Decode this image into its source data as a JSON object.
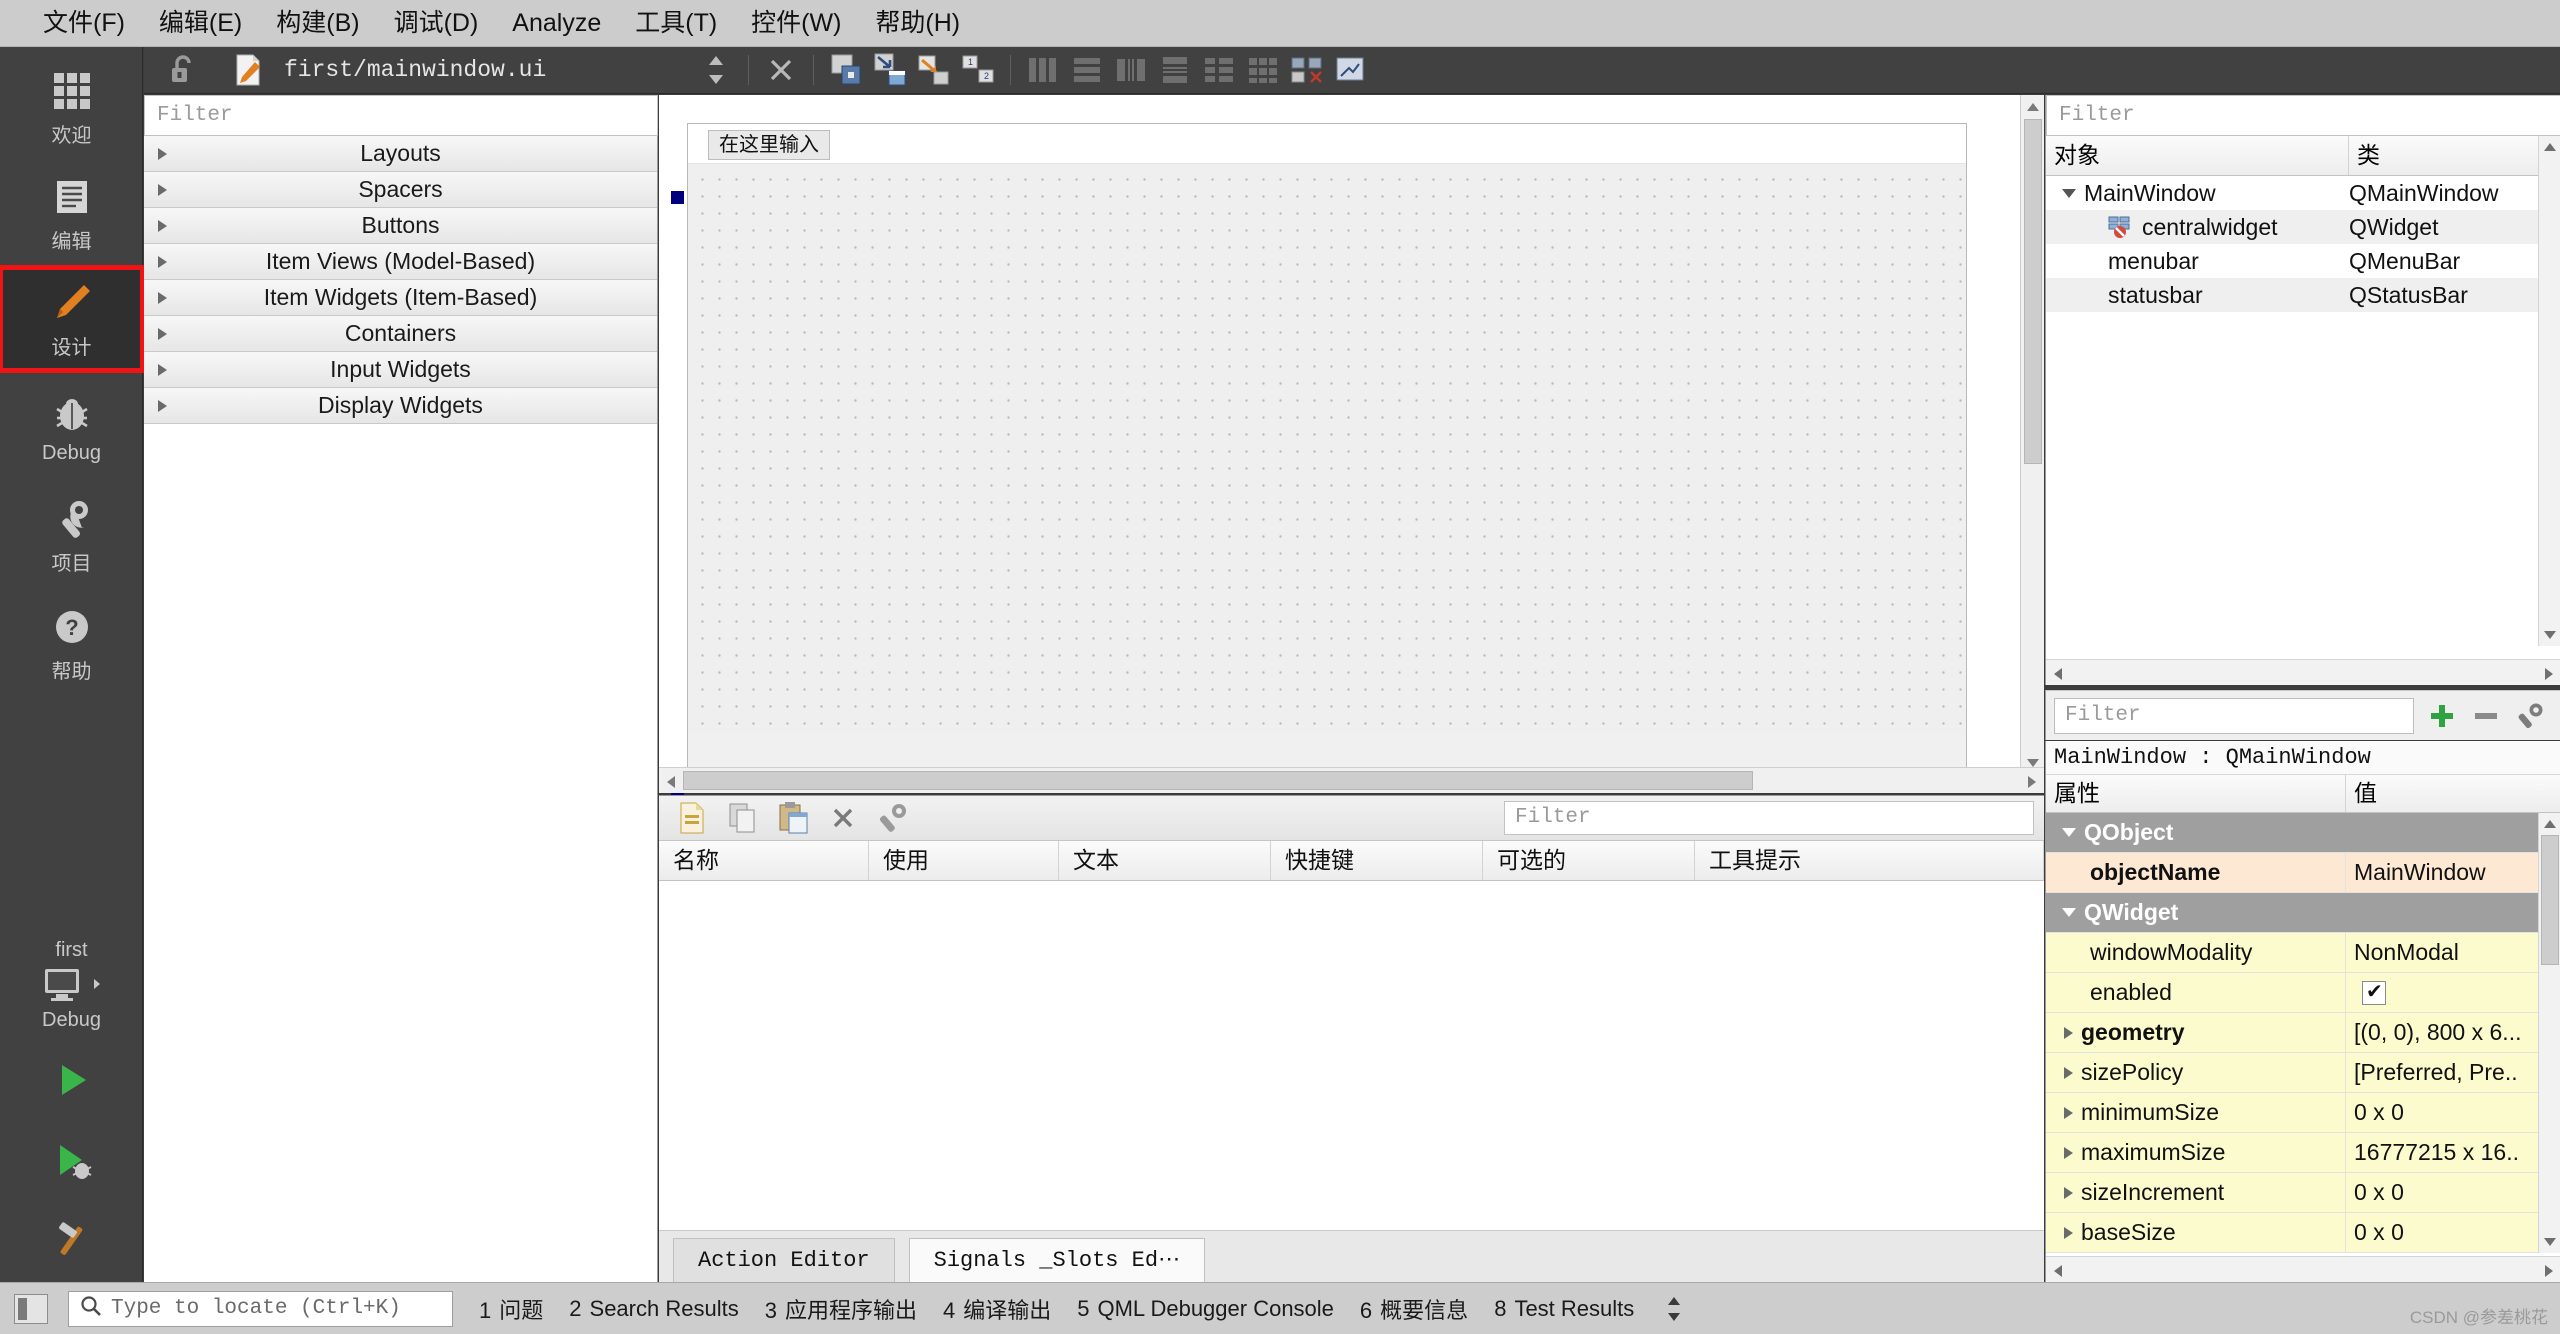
{
  "menubar": {
    "items": [
      {
        "label": "文件(F)",
        "name": "menu-file"
      },
      {
        "label": "编辑(E)",
        "name": "menu-edit"
      },
      {
        "label": "构建(B)",
        "name": "menu-build"
      },
      {
        "label": "调试(D)",
        "name": "menu-debug"
      },
      {
        "label": "Analyze",
        "name": "menu-analyze"
      },
      {
        "label": "工具(T)",
        "name": "menu-tools"
      },
      {
        "label": "控件(W)",
        "name": "menu-window"
      },
      {
        "label": "帮助(H)",
        "name": "menu-help"
      }
    ]
  },
  "modebar": {
    "items": [
      {
        "label": "欢迎",
        "icon": "grid-icon",
        "selected": false
      },
      {
        "label": "编辑",
        "icon": "document-lines-icon",
        "selected": false
      },
      {
        "label": "设计",
        "icon": "pencil-icon",
        "selected": true
      },
      {
        "label": "Debug",
        "icon": "bug-icon",
        "selected": false
      },
      {
        "label": "项目",
        "icon": "wrench-icon",
        "selected": false
      },
      {
        "label": "帮助",
        "icon": "question-circle-icon",
        "selected": false
      }
    ],
    "kit": {
      "project": "first",
      "build_config": "Debug",
      "computer_icon": "monitor-icon",
      "chevron": "chevron-right-icon"
    },
    "run_buttons": [
      {
        "name": "run-button",
        "icon": "play-triangle-icon"
      },
      {
        "name": "debug-button",
        "icon": "play-bug-icon"
      },
      {
        "name": "build-button",
        "icon": "hammer-icon"
      }
    ]
  },
  "editor_toolbar": {
    "lock_icon": "unlocked-padlock-icon",
    "file_icon": "file-pencil-icon",
    "file_path": "first/mainwindow.ui",
    "split_icon": "updown-arrows-icon",
    "close_icon": "close-x-icon",
    "design_tools": [
      {
        "name": "edit-widgets-tool",
        "icon": "edit-widgets-icon"
      },
      {
        "name": "edit-signals-slots-tool",
        "icon": "signals-slots-icon"
      },
      {
        "name": "edit-buddies-tool",
        "icon": "buddies-icon"
      },
      {
        "name": "edit-tab-order-tool",
        "icon": "tab-order-icon"
      },
      {
        "name": "layout-horizontally-tool",
        "icon": "layout-horizontal-icon"
      },
      {
        "name": "layout-vertically-tool",
        "icon": "layout-vertical-icon"
      },
      {
        "name": "layout-splitter-horizontal-tool",
        "icon": "split-horizontal-icon"
      },
      {
        "name": "layout-splitter-vertical-tool",
        "icon": "split-vertical-icon"
      },
      {
        "name": "layout-form-tool",
        "icon": "layout-form-icon"
      },
      {
        "name": "layout-grid-tool",
        "icon": "layout-grid-icon"
      },
      {
        "name": "break-layout-tool",
        "icon": "break-layout-icon"
      },
      {
        "name": "adjust-size-tool",
        "icon": "adjust-size-icon"
      }
    ]
  },
  "widget_box": {
    "filter_placeholder": "Filter",
    "filter_value": "",
    "categories": [
      {
        "label": "Layouts"
      },
      {
        "label": "Spacers"
      },
      {
        "label": "Buttons"
      },
      {
        "label": "Item Views (Model-Based)"
      },
      {
        "label": "Item Widgets (Item-Based)"
      },
      {
        "label": "Containers"
      },
      {
        "label": "Input Widgets"
      },
      {
        "label": "Display Widgets"
      }
    ]
  },
  "form_canvas": {
    "menu_placeholder": "在这里输入",
    "selection_handles": 3
  },
  "action_editor": {
    "filter_placeholder": "Filter",
    "filter_value": "",
    "toolbar_icons": [
      {
        "name": "new-action-button",
        "icon": "new-action-icon"
      },
      {
        "name": "copy-action-button",
        "icon": "copy-icon"
      },
      {
        "name": "paste-action-button",
        "icon": "paste-icon"
      },
      {
        "name": "delete-action-button",
        "icon": "delete-x-icon"
      },
      {
        "name": "edit-action-button",
        "icon": "wrench-small-icon"
      }
    ],
    "columns": [
      "名称",
      "使用",
      "文本",
      "快捷键",
      "可选的",
      "工具提示"
    ],
    "rows": [],
    "tabs": [
      {
        "label": "Action Editor",
        "active": false
      },
      {
        "label": "Signals _Slots Ed⋯",
        "active": true
      }
    ]
  },
  "object_inspector": {
    "filter_placeholder": "Filter",
    "filter_value": "",
    "columns": [
      "对象",
      "类"
    ],
    "rows": [
      {
        "name": "MainWindow",
        "class": "QMainWindow",
        "depth": 0,
        "expander": "caret-down-icon",
        "icon": ""
      },
      {
        "name": "centralwidget",
        "class": "QWidget",
        "depth": 1,
        "expander": "",
        "icon": "no-layout-icon"
      },
      {
        "name": "menubar",
        "class": "QMenuBar",
        "depth": 1,
        "expander": "",
        "icon": ""
      },
      {
        "name": "statusbar",
        "class": "QStatusBar",
        "depth": 1,
        "expander": "",
        "icon": ""
      }
    ]
  },
  "property_filter": {
    "placeholder": "Filter",
    "value": "",
    "buttons": [
      {
        "name": "add-property-button",
        "icon": "plus-green-icon"
      },
      {
        "name": "remove-property-button",
        "icon": "minus-gray-icon"
      },
      {
        "name": "configure-button",
        "icon": "wrench-icon"
      }
    ]
  },
  "property_editor": {
    "title": "MainWindow : QMainWindow",
    "columns": [
      "属性",
      "值"
    ],
    "rows": [
      {
        "prop": "QObject",
        "value": "",
        "kind": "group",
        "expander": "caret-down-icon"
      },
      {
        "prop": "objectName",
        "value": "MainWindow",
        "kind": "peach",
        "bold": true,
        "expander": ""
      },
      {
        "prop": "QWidget",
        "value": "",
        "kind": "group",
        "expander": "caret-down-icon"
      },
      {
        "prop": "windowModality",
        "value": "NonModal",
        "kind": "yellow",
        "expander": ""
      },
      {
        "prop": "enabled",
        "value": "",
        "kind": "yellow",
        "expander": "",
        "checkbox": true
      },
      {
        "prop": "geometry",
        "value": "[(0, 0), 800 x 6...",
        "kind": "yellow",
        "bold": true,
        "expander": "caret-right-icon"
      },
      {
        "prop": "sizePolicy",
        "value": "[Preferred, Pre..",
        "kind": "yellow",
        "expander": "caret-right-icon"
      },
      {
        "prop": "minimumSize",
        "value": "0 x 0",
        "kind": "yellow",
        "expander": "caret-right-icon"
      },
      {
        "prop": "maximumSize",
        "value": "16777215 x 16..",
        "kind": "yellow",
        "expander": "caret-right-icon"
      },
      {
        "prop": "sizeIncrement",
        "value": "0 x 0",
        "kind": "yellow",
        "expander": "caret-right-icon"
      },
      {
        "prop": "baseSize",
        "value": "0 x 0",
        "kind": "yellow",
        "expander": "caret-right-icon"
      }
    ]
  },
  "statusbar": {
    "sidebar_toggle": "sidebar-toggle-icon",
    "locator": {
      "icon": "search-icon",
      "placeholder": "Type to locate (Ctrl+K)",
      "value": ""
    },
    "outputs": [
      {
        "num": "1",
        "label": "问题"
      },
      {
        "num": "2",
        "label": "Search Results"
      },
      {
        "num": "3",
        "label": "应用程序输出"
      },
      {
        "num": "4",
        "label": "编译输出"
      },
      {
        "num": "5",
        "label": "QML Debugger Console"
      },
      {
        "num": "6",
        "label": "概要信息"
      },
      {
        "num": "8",
        "label": "Test Results"
      }
    ],
    "expander_icon": "updown-arrows-icon",
    "watermark": "CSDN @参差桃花"
  },
  "colors": {
    "accent_orange": "#e08020",
    "selection_red": "#f01414",
    "dark_panel": "#414141",
    "menu_gray": "#cccccc",
    "property_yellow": "#fbfbcd",
    "property_peach": "#fde8d4",
    "group_gray": "#9f9f9f"
  }
}
